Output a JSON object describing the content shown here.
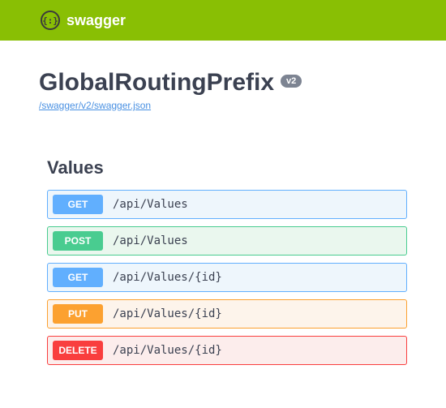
{
  "header": {
    "brand": "swagger",
    "logo_glyph": "{:}"
  },
  "api": {
    "title": "GlobalRoutingPrefix",
    "version": "v2",
    "spec_url": "/swagger/v2/swagger.json"
  },
  "tag": {
    "name": "Values",
    "operations": [
      {
        "method": "GET",
        "css": "get",
        "path": "/api/Values"
      },
      {
        "method": "POST",
        "css": "post",
        "path": "/api/Values"
      },
      {
        "method": "GET",
        "css": "get",
        "path": "/api/Values/{id}"
      },
      {
        "method": "PUT",
        "css": "put",
        "path": "/api/Values/{id}"
      },
      {
        "method": "DELETE",
        "css": "delete",
        "path": "/api/Values/{id}"
      }
    ]
  }
}
